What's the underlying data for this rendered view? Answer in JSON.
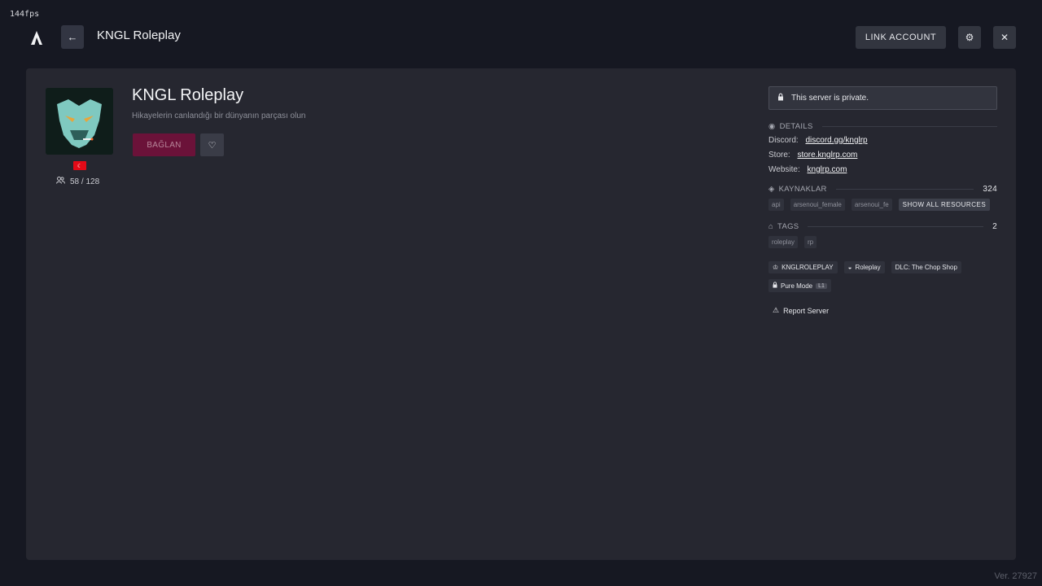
{
  "fps": "144fps",
  "top_bar": {
    "logo_icon": "fivem-logo-icon",
    "back_icon": "arrow-left-icon",
    "title": "KNGL Roleplay",
    "link_account_label": "LINK ACCOUNT",
    "settings_icon": "gear-icon",
    "close_icon": "close-icon"
  },
  "server": {
    "name": "KNGL Roleplay",
    "description": "Hikayelerin canlandığı bir dünyanın parçası olun",
    "connect_label": "BAĞLAN",
    "favorite_icon": "heart-icon",
    "flag_icon": "turkey-flag-icon",
    "players": "58 / 128"
  },
  "sidebar": {
    "private_notice": "This server is private.",
    "details": {
      "label": "DETAILS",
      "rows": [
        {
          "key": "Discord:",
          "value": "discord.gg/knglrp"
        },
        {
          "key": "Store:",
          "value": "store.knglrp.com"
        },
        {
          "key": "Website:",
          "value": "knglrp.com"
        }
      ]
    },
    "resources": {
      "label": "KAYNAKLAR",
      "count": "324",
      "items": [
        "api",
        "arsenoui_female",
        "arsenoui_fe"
      ],
      "show_all_label": "SHOW ALL RESOURCES"
    },
    "tags": {
      "label": "TAGS",
      "count": "2",
      "items": [
        "roleplay",
        "rp"
      ]
    },
    "features": {
      "owner": "KNGLROLEPLAY",
      "gamemode": "Roleplay",
      "dlc": "DLC: The Chop Shop",
      "pure_mode": "Pure Mode",
      "pure_level": "L1"
    },
    "report_label": "Report Server"
  },
  "version": "Ver. 27927"
}
